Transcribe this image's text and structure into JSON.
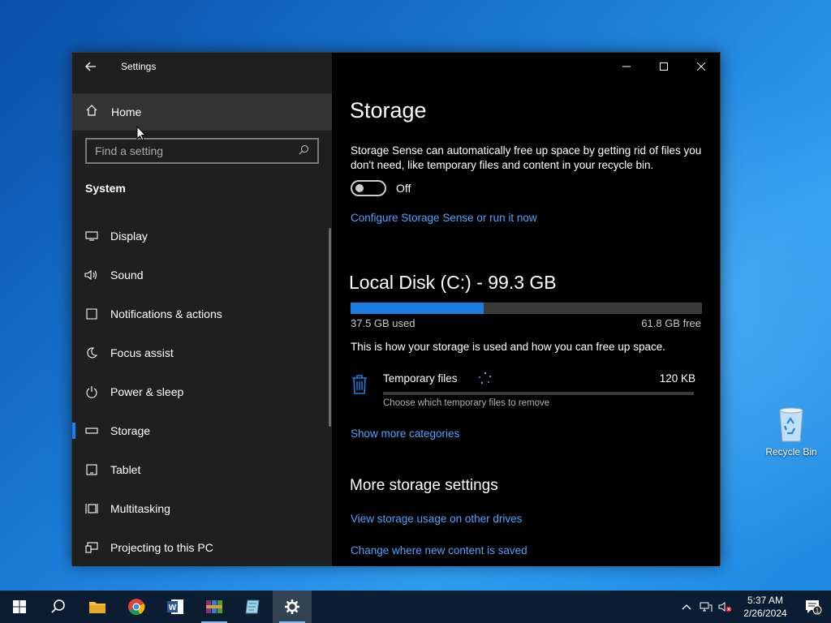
{
  "desktop": {
    "recycle_bin_label": "Recycle Bin"
  },
  "window": {
    "app_title": "Settings",
    "back_icon": "back-arrow-icon",
    "controls": [
      "minimize",
      "maximize",
      "close"
    ]
  },
  "sidebar": {
    "home_label": "Home",
    "search_placeholder": "Find a setting",
    "section_title": "System",
    "items": [
      {
        "label": "Display",
        "icon": "display-icon"
      },
      {
        "label": "Sound",
        "icon": "speaker-icon"
      },
      {
        "label": "Notifications & actions",
        "icon": "notification-icon"
      },
      {
        "label": "Focus assist",
        "icon": "moon-icon"
      },
      {
        "label": "Power & sleep",
        "icon": "power-icon"
      },
      {
        "label": "Storage",
        "icon": "storage-icon",
        "active": true
      },
      {
        "label": "Tablet",
        "icon": "tablet-icon"
      },
      {
        "label": "Multitasking",
        "icon": "multitasking-icon"
      },
      {
        "label": "Projecting to this PC",
        "icon": "projecting-icon"
      }
    ]
  },
  "main": {
    "title": "Storage",
    "description": "Storage Sense can automatically free up space by getting rid of files you don't need, like temporary files and content in your recycle bin.",
    "toggle_state": "Off",
    "configure_link": "Configure Storage Sense or run it now",
    "disk_title": "Local Disk (C:) - 99.3 GB",
    "used_label": "37.5 GB used",
    "free_label": "61.8 GB free",
    "used_fraction": 0.378,
    "howto": "This is how your storage is used and how you can free up space.",
    "temp_files": {
      "name": "Temporary files",
      "size": "120 KB",
      "description": "Choose which temporary files to remove"
    },
    "show_more_link": "Show more categories",
    "more_title": "More storage settings",
    "other_drives_link": "View storage usage on other drives",
    "change_link": "Change where new content is saved"
  },
  "taskbar": {
    "apps": [
      "start",
      "search",
      "file-explorer",
      "chrome",
      "word",
      "winrar",
      "notepad",
      "settings"
    ],
    "time": "5:37 AM",
    "date": "2/26/2024",
    "notification_count": "1"
  },
  "colors": {
    "accent": "#0a84ff",
    "link": "#4da3ff",
    "bar_fill": "#1a7ee0"
  }
}
